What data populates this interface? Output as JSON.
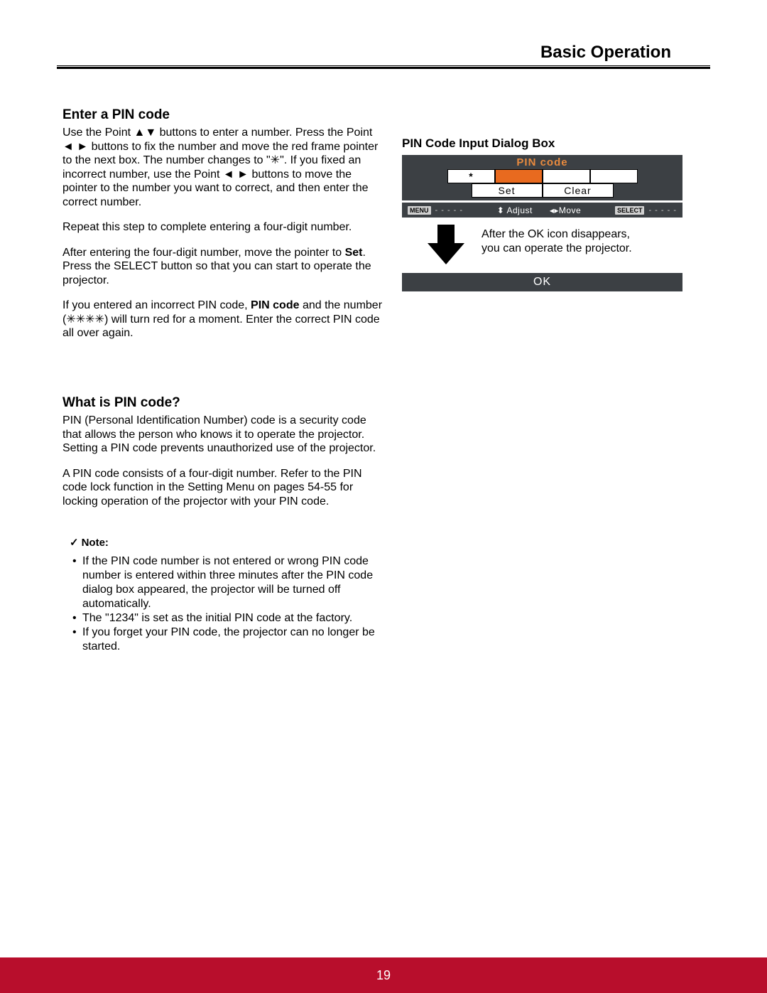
{
  "header": {
    "section": "Basic Operation"
  },
  "left": {
    "enter_title": "Enter a PIN code",
    "para1_pre": "Use the Point ▲▼ buttons to enter a number. Press the Point ◄ ► buttons to fix the number and move the red frame pointer to the next box. The number changes to \"✳\". If you fixed an incorrect number, use the Point ◄ ► buttons to move the pointer to the number you want to correct, and then enter the correct number.",
    "para2": "Repeat this step to complete entering a four-digit number.",
    "para3_a": "After entering the four-digit number, move the pointer to ",
    "para3_set": "Set",
    "para3_b": ". Press the SELECT button so that you can start to operate the projector.",
    "para4_a": "If you entered an incorrect PIN code, ",
    "para4_pin": "PIN code",
    "para4_b": " and the number (✳✳✳✳) will turn red for a moment. Enter the correct PIN code all over again.",
    "what_title": "What is PIN code?",
    "what_p1": "PIN (Personal Identification Number) code is a security code that allows the person who knows it to operate the projector. Setting a PIN code prevents unauthorized use of the projector.",
    "what_p2": "A PIN code consists of a four-digit number. Refer to the PIN code lock function in the Setting Menu on pages 54-55 for locking operation of the projector with your PIN code."
  },
  "note": {
    "label": "Note:",
    "items": [
      "If the PIN code number is not entered or wrong PIN code number is entered within three minutes after the PIN code dialog box appeared, the projector will be turned off automatically.",
      "The \"1234\" is set as the initial PIN code at the factory.",
      "If you forget your PIN code, the projector can no longer be started."
    ]
  },
  "right": {
    "title": "PIN Code Input Dialog Box",
    "dialog_header": "PIN code",
    "cells": [
      "*",
      "",
      "",
      ""
    ],
    "set_label": "Set",
    "clear_label": "Clear",
    "menu_tag": "MENU",
    "select_tag": "SELECT",
    "dashes": "- - - - -",
    "adjust_icon": "⬍",
    "adjust": "Adjust",
    "move_icon": "◂▸",
    "move": "Move",
    "arrow_text_l1": "After the OK icon disappears,",
    "arrow_text_l2": "you can operate the projector.",
    "ok_label": "OK"
  },
  "footer": {
    "page": "19"
  }
}
